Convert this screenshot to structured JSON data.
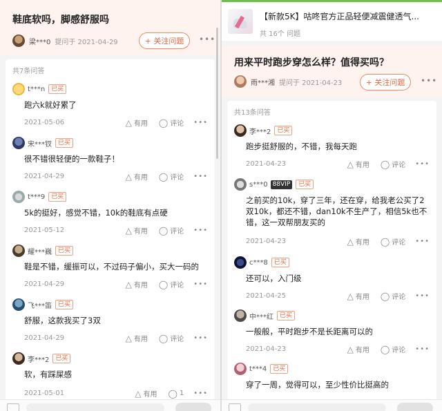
{
  "left": {
    "question": {
      "title": "鞋底软吗，脚感舒服吗",
      "asker": "梁***0",
      "asked_at": "提问于 2021-04-29",
      "follow_label": "+ 关注问题"
    },
    "answer_count": "共7条问答",
    "answers": [
      {
        "user": "t***n",
        "tag": "已买",
        "text": "跑六k就好累了",
        "date": "2021-05-06",
        "useful": "有用",
        "comment": "评论"
      },
      {
        "user": "宋***钗",
        "tag": "已买",
        "text": "很不错很轻便的一款鞋子！",
        "date": "2021-04-29",
        "useful": "有用",
        "comment": "评论"
      },
      {
        "user": "t***9",
        "tag": "已买",
        "text": "5k的挺好，感觉不错，10k的鞋底有点硬",
        "date": "2021-05-12",
        "useful": "有用",
        "comment": "评论"
      },
      {
        "user": "耀***巍",
        "tag": "已买",
        "text": "鞋是不错，缓振可以，不过码子偏小，买大一码的",
        "date": "2021-04-29",
        "useful": "有用",
        "comment": "评论"
      },
      {
        "user": "飞***笛",
        "tag": "已买",
        "text": "舒服，这款我买了3双",
        "date": "2021-04-29",
        "useful": "有用",
        "comment": "评论"
      },
      {
        "user": "李***2",
        "tag": "已买",
        "text": "软，有踩屎感",
        "date": "2021-05-01",
        "useful": "有用",
        "comment": "1"
      }
    ]
  },
  "right": {
    "product": {
      "title": "【新款5K】咕咚官方正品轻便减震健透气...",
      "count": "共 16个 问题"
    },
    "question": {
      "title": "用来平时跑步穿怎么样？值得买吗？",
      "asker": "雨***湘",
      "asked_at": "提问于 2021-04-23",
      "follow_label": "+ 关注问题"
    },
    "answer_count": "共13条问答",
    "answers": [
      {
        "user": "李***2",
        "tag": "已买",
        "vip": "",
        "text": "跑步挺舒服的，不错，我每天跑",
        "date": "2021-04-23",
        "useful": "有用",
        "comment": "评论"
      },
      {
        "user": "s***0",
        "tag": "已买",
        "vip": "88VIP",
        "text": "之前买的10k，穿了三年，还在穿，给我老公买了2双10k，都还不错，dan10k不生产了，相信5k也不错，这一双帮朋友买的",
        "date": "2021-04-23",
        "useful": "有用",
        "comment": "评论"
      },
      {
        "user": "c***8",
        "tag": "已买",
        "vip": "",
        "text": "还可以，入门级",
        "date": "2021-04-25",
        "useful": "有用",
        "comment": "评论"
      },
      {
        "user": "中***红",
        "tag": "已买",
        "vip": "",
        "text": "一般般，平时跑步不是长距离可以的",
        "date": "2021-04-23",
        "useful": "有用",
        "comment": "评论"
      },
      {
        "user": "t***4",
        "tag": "已买",
        "vip": "",
        "text": "穿了一周，觉得可以，至少性价比挺高的",
        "date": "",
        "useful": "",
        "comment": ""
      }
    ]
  },
  "colors": {
    "accent": "#e8663b",
    "header_bg": "#fff3ef",
    "green": "#6cc04a"
  },
  "icons": {
    "useful": "thumb-triangle-icon",
    "comment": "comment-bubble-icon",
    "more": "more-dots-icon"
  }
}
